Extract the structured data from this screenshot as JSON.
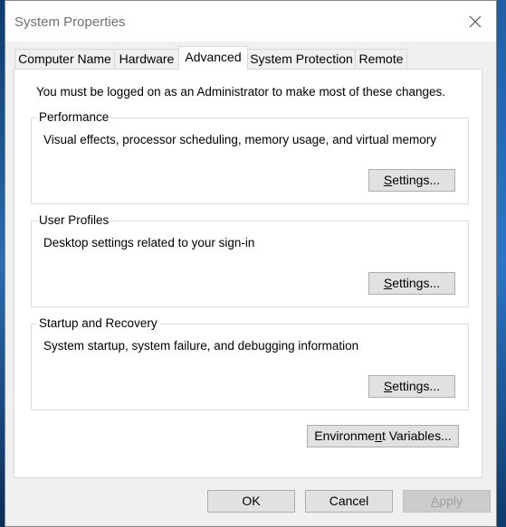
{
  "window": {
    "title": "System Properties"
  },
  "tabs": [
    {
      "label": "Computer Name"
    },
    {
      "label": "Hardware"
    },
    {
      "label": "Advanced"
    },
    {
      "label": "System Protection"
    },
    {
      "label": "Remote"
    }
  ],
  "active_tab": "Advanced",
  "panel": {
    "admin_note": "You must be logged on as an Administrator to make most of these changes.",
    "groups": [
      {
        "title": "Performance",
        "description": "Visual effects, processor scheduling, memory usage, and virtual memory",
        "button_mnemonic": "S",
        "button_rest": "ettings..."
      },
      {
        "title": "User Profiles",
        "description": "Desktop settings related to your sign-in",
        "button_mnemonic": "S",
        "button_rest": "ettings..."
      },
      {
        "title": "Startup and Recovery",
        "description": "System startup, system failure, and debugging information",
        "button_mnemonic": "S",
        "button_rest": "ettings..."
      }
    ],
    "env_button": {
      "before": "Environme",
      "mnemonic": "n",
      "after": "t Variables..."
    }
  },
  "footer": {
    "ok": "OK",
    "cancel": "Cancel",
    "apply_mnemonic": "A",
    "apply_rest": "pply"
  },
  "icons": {
    "close": "close-icon"
  }
}
